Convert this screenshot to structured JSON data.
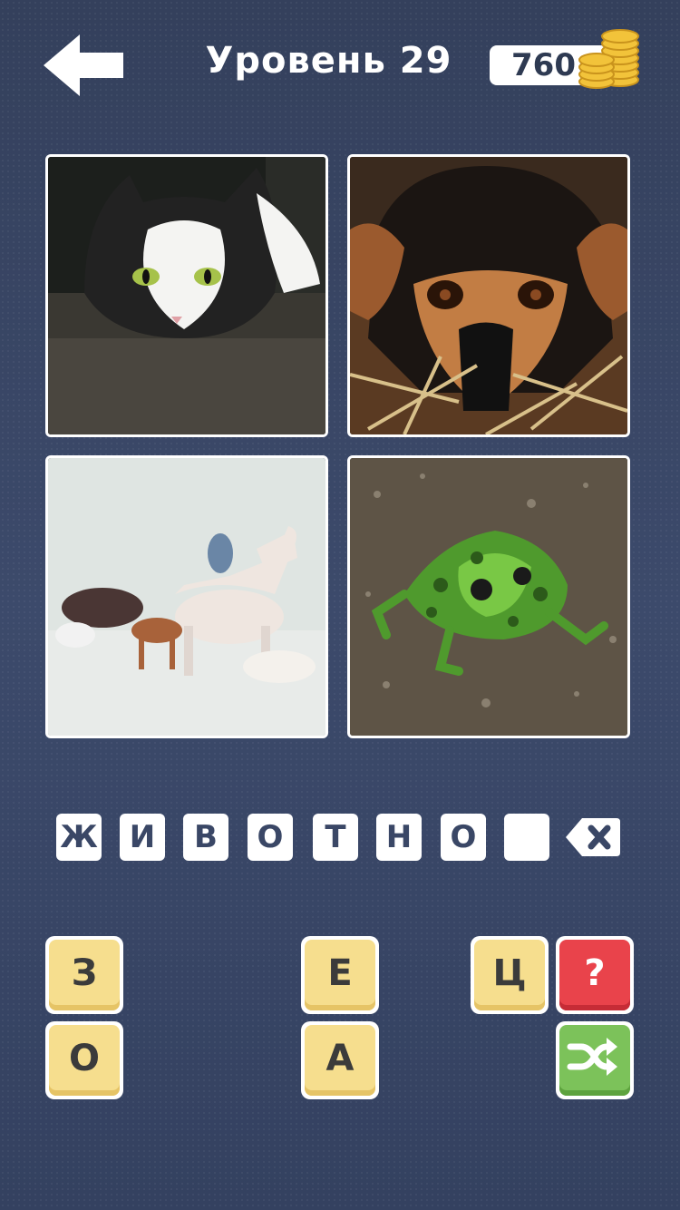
{
  "header": {
    "title": "Уровень 29",
    "coins": "760"
  },
  "pictures": [
    {
      "subject": "cat"
    },
    {
      "subject": "dog"
    },
    {
      "subject": "toy-animals"
    },
    {
      "subject": "frog"
    }
  ],
  "answer": {
    "slots": [
      "Ж",
      "И",
      "В",
      "О",
      "Т",
      "Н",
      "О",
      ""
    ]
  },
  "keyboard": {
    "letters": [
      "З",
      "Е",
      "Ц",
      "О",
      "А"
    ],
    "hint_symbol": "?"
  },
  "colors": {
    "background": "#3a4766",
    "tile_yellow": "#f6de8e",
    "hint_red": "#e9434b",
    "shuffle_green": "#7cc25a"
  },
  "icons": [
    "back-arrow-icon",
    "coin-stack-icon",
    "backspace-icon",
    "shuffle-icon"
  ]
}
